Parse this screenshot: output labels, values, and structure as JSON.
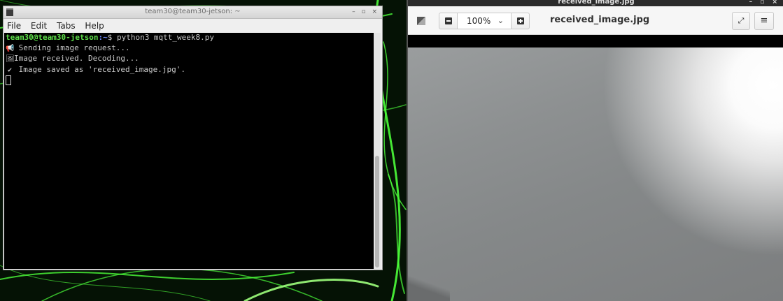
{
  "terminal": {
    "title": "team30@team30-jetson: ~",
    "window_controls": "– ▫ ×",
    "menu": [
      "File",
      "Edit",
      "Tabs",
      "Help"
    ],
    "prompt_user": "team30@team30-jetson",
    "prompt_path": ":~",
    "prompt_symbol": "$ ",
    "command": "python3 mqtt_week8.py",
    "output": [
      {
        "icon": "megaphone-icon",
        "text": " Sending image request..."
      },
      {
        "icon": "image-icon",
        "text": "Image received. Decoding..."
      },
      {
        "icon": "checkmark-icon",
        "text": " Image saved as 'received_image.jpg'."
      }
    ]
  },
  "viewer": {
    "title": "received_image.jpg",
    "window_controls": "– ▫ ×",
    "zoom": "100%",
    "filename": "received_image.jpg",
    "fullscreen_glyph": "⤢",
    "menu_glyph": "≡"
  },
  "colors": {
    "wallpaper_line": "#4cff3a",
    "prompt_user": "#5ee14a",
    "prompt_path": "#6f8cff"
  }
}
